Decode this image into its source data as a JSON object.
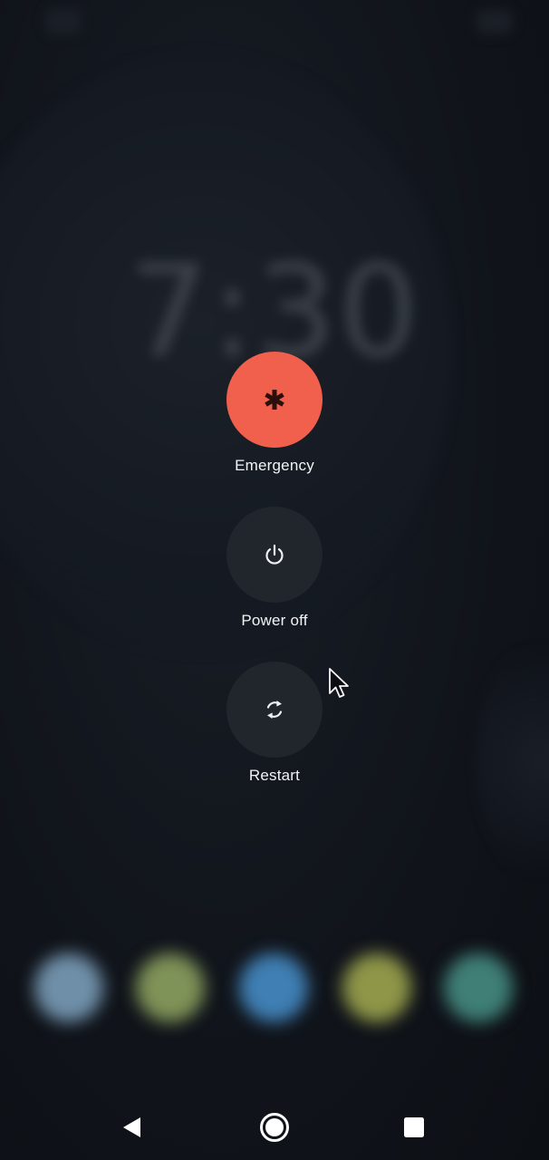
{
  "lockscreen": {
    "clock": "7:30"
  },
  "power_menu": {
    "emergency": {
      "label": "Emergency",
      "icon": "asterisk-icon",
      "color": "#f1604d"
    },
    "power_off": {
      "label": "Power off",
      "icon": "power-icon"
    },
    "restart": {
      "label": "Restart",
      "icon": "restart-icon"
    }
  },
  "dock": {
    "apps": [
      {
        "name": "app-1",
        "color": "#6f8fa8"
      },
      {
        "name": "app-2",
        "color": "#7f9257"
      },
      {
        "name": "app-3",
        "color": "#3f7fb3"
      },
      {
        "name": "app-4",
        "color": "#8f9648"
      },
      {
        "name": "app-5",
        "color": "#3f7f76"
      }
    ]
  },
  "navbar": {
    "back": "back-icon",
    "home": "home-icon",
    "recents": "recents-icon"
  }
}
